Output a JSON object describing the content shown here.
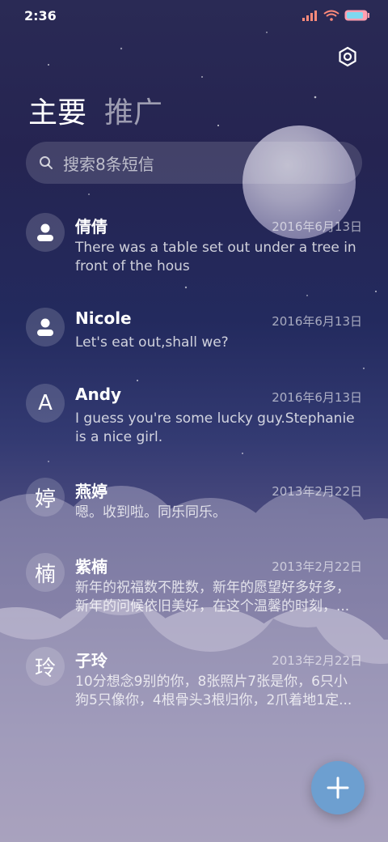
{
  "status_bar": {
    "time": "2:36",
    "signal_icon": "signal-icon",
    "wifi_icon": "wifi-icon",
    "battery_icon": "battery-icon"
  },
  "header": {
    "settings_icon": "gear-icon",
    "tabs": [
      {
        "label": "主要",
        "active": true
      },
      {
        "label": "推广",
        "active": false
      }
    ]
  },
  "search": {
    "placeholder": "搜索8条短信",
    "icon": "search-icon"
  },
  "conversations": [
    {
      "avatar": "",
      "avatar_icon": "person-icon",
      "name": "倩倩",
      "date": "2016年6月13日",
      "preview": "There was a table set out under a tree in front of the hous"
    },
    {
      "avatar": "",
      "avatar_icon": "person-icon",
      "name": "Nicole",
      "date": "2016年6月13日",
      "preview": "Let's eat out,shall we?"
    },
    {
      "avatar": "A",
      "name": "Andy",
      "date": "2016年6月13日",
      "preview": "I guess you're some lucky guy.Stephanie is a nice girl."
    },
    {
      "avatar": "婷",
      "name": "燕婷",
      "date": "2013年2月22日",
      "preview": "嗯。收到啦。同乐同乐。"
    },
    {
      "avatar": "楠",
      "name": "紫楠",
      "date": "2013年2月22日",
      "preview": "新年的祝福数不胜数，新年的愿望好多好多，新年的问候依旧美好，在这个温馨的时刻，..."
    },
    {
      "avatar": "玲",
      "name": "子玲",
      "date": "2013年2月22日",
      "preview": "10分想念9别的你，8张照片7张是你，6只小狗5只像你，4根骨头3根归你，2爪着地1定..."
    }
  ],
  "fab": {
    "icon": "plus-icon"
  },
  "colors": {
    "fab": "#6d9fd0"
  }
}
